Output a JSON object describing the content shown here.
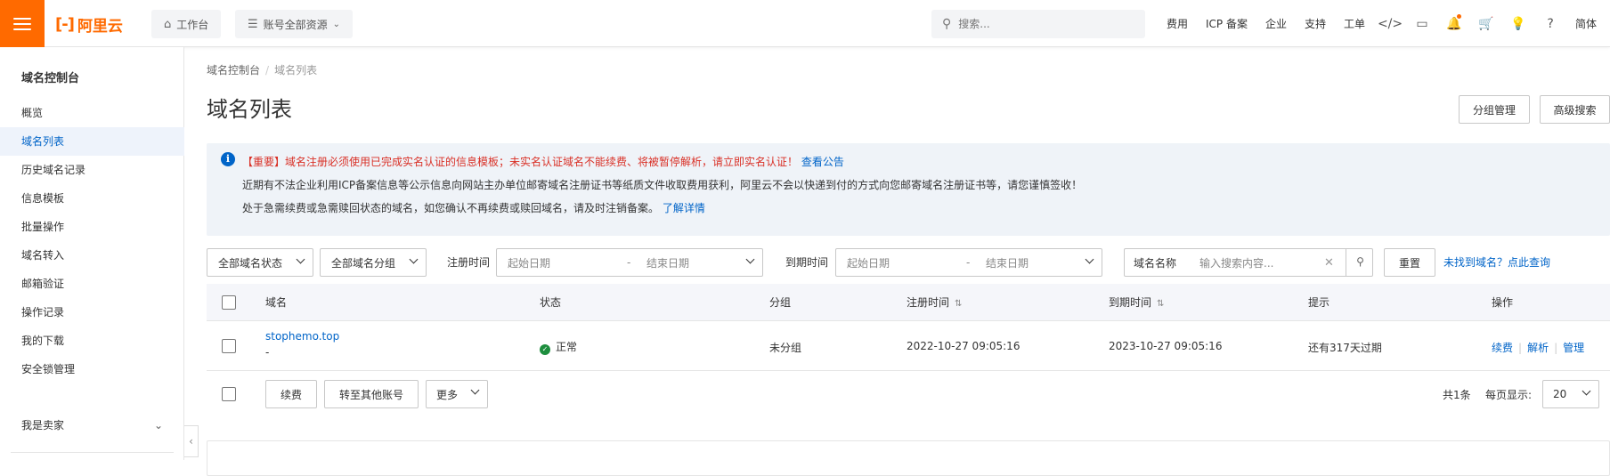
{
  "header": {
    "logo_text": "阿里云",
    "logo_mark": "[-]",
    "workbench_label": "工作台",
    "resource_label": "账号全部资源",
    "search_placeholder": "搜索...",
    "links": [
      "费用",
      "ICP 备案",
      "企业",
      "支持",
      "工单"
    ],
    "lang_label": "简体"
  },
  "sidebar": {
    "title": "域名控制台",
    "items": [
      {
        "label": "概览",
        "active": false
      },
      {
        "label": "域名列表",
        "active": true
      },
      {
        "label": "历史域名记录",
        "active": false
      },
      {
        "label": "信息模板",
        "active": false
      },
      {
        "label": "批量操作",
        "active": false
      },
      {
        "label": "域名转入",
        "active": false
      },
      {
        "label": "邮箱验证",
        "active": false
      },
      {
        "label": "操作记录",
        "active": false
      },
      {
        "label": "我的下载",
        "active": false
      },
      {
        "label": "安全锁管理",
        "active": false
      }
    ],
    "seller_label": "我是卖家"
  },
  "breadcrumb": {
    "root": "域名控制台",
    "current": "域名列表"
  },
  "page": {
    "title": "域名列表",
    "group_manage_label": "分组管理",
    "advanced_search_label": "高级搜索"
  },
  "notice": {
    "line1_red": "【重要】域名注册必须使用已完成实名认证的信息模板；未实名认证域名不能续费、将被暂停解析，请立即实名认证！",
    "line1_link": "查看公告",
    "line2": "近期有不法企业利用ICP备案信息等公示信息向网站主办单位邮寄域名注册证书等纸质文件收取费用获利，阿里云不会以快递到付的方式向您邮寄域名注册证书等，请您谨慎签收！",
    "line3": "处于急需续费或急需赎回状态的域名，如您确认不再续费或赎回域名，请及时注销备案。",
    "line3_link": "了解详情"
  },
  "filters": {
    "status_select": "全部域名状态",
    "group_select": "全部域名分组",
    "reg_time_label": "注册时间",
    "expire_time_label": "到期时间",
    "start_placeholder": "起始日期",
    "end_placeholder": "结束日期",
    "range_sep": "-",
    "name_select": "域名名称",
    "search_placeholder": "输入搜索内容...",
    "reset_label": "重置",
    "not_found_link": "未找到域名？点此查询"
  },
  "table": {
    "columns": [
      "域名",
      "状态",
      "分组",
      "注册时间",
      "到期时间",
      "提示",
      "操作"
    ],
    "rows": [
      {
        "domain": "stophemo.top",
        "sub": "-",
        "status": "正常",
        "group": "未分组",
        "reg_time": "2022-10-27 09:05:16",
        "expire_time": "2023-10-27 09:05:16",
        "hint": "还有317天过期",
        "ops": [
          "续费",
          "解析",
          "管理"
        ]
      }
    ]
  },
  "footer": {
    "renew_label": "续费",
    "transfer_label": "转至其他账号",
    "more_label": "更多",
    "total_text": "共1条",
    "per_page_label": "每页显示:",
    "per_page_value": "20"
  },
  "colors": {
    "brand": "#ff6a00",
    "link": "#0064c8",
    "warning": "#d93026",
    "success": "#1e8e3e"
  }
}
